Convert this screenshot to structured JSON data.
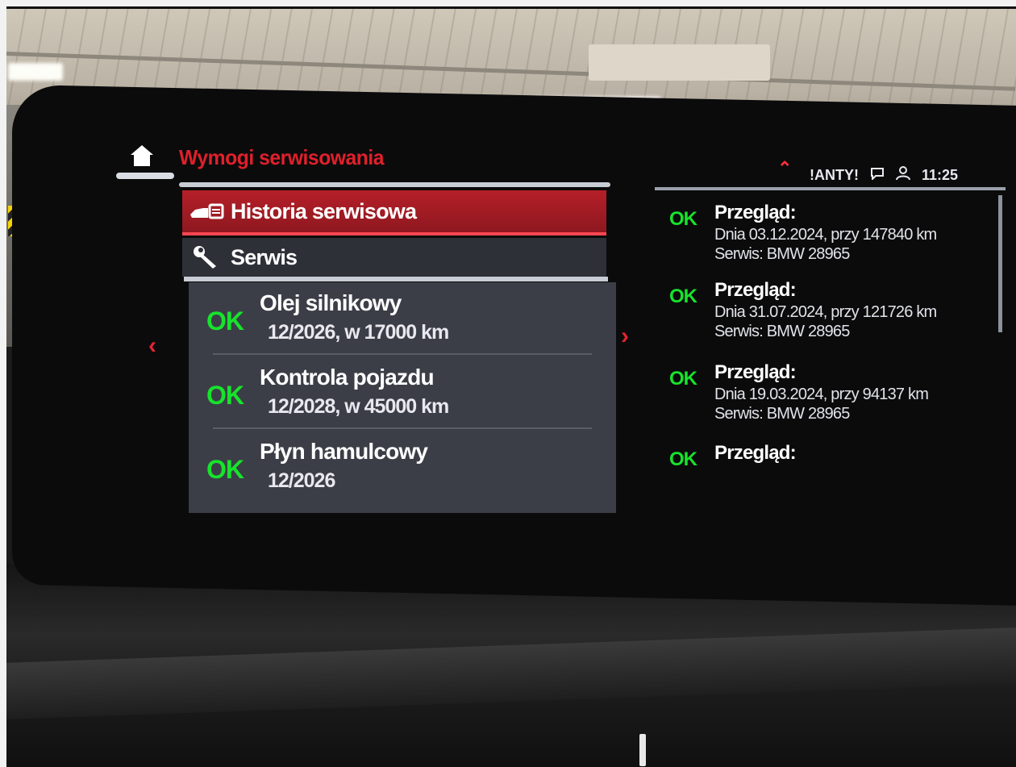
{
  "screen": {
    "title": "Wymogi serwisowania",
    "menu": [
      {
        "label": "Historia serwisowa",
        "icon": "car-history-icon",
        "selected": true
      },
      {
        "label": "Serwis",
        "icon": "wrench-icon",
        "selected": false
      }
    ],
    "items": [
      {
        "status": "OK",
        "name": "Olej silnikowy",
        "due": "12/2026, w 17000 km"
      },
      {
        "status": "OK",
        "name": "Kontrola pojazdu",
        "due": "12/2028, w 45000 km"
      },
      {
        "status": "OK",
        "name": "Płyn hamulcowy",
        "due": "12/2026"
      }
    ]
  },
  "status_bar": {
    "network": "!ANTY!",
    "time": "11:25"
  },
  "history": [
    {
      "status": "OK",
      "title": "Przegląd:",
      "line1": "Dnia 03.12.2024, przy 147840 km",
      "line2": "Serwis: BMW 28965"
    },
    {
      "status": "OK",
      "title": "Przegląd:",
      "line1": "Dnia 31.07.2024, przy 121726 km",
      "line2": "Serwis: BMW 28965"
    },
    {
      "status": "OK",
      "title": "Przegląd:",
      "line1": "Dnia 19.03.2024, przy 94137 km",
      "line2": "Serwis: BMW 28965"
    },
    {
      "status": "OK",
      "title": "Przegląd:"
    }
  ],
  "colors": {
    "accent_red": "#e0202a",
    "ok_green": "#17e32c",
    "panel_bg": "#3c3e47"
  }
}
